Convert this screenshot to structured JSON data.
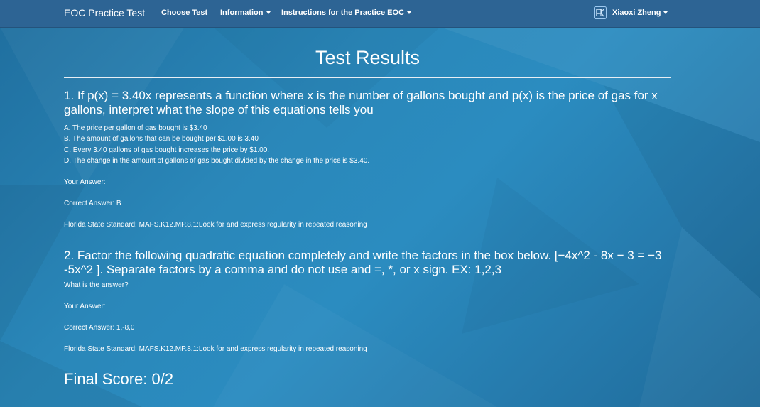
{
  "navbar": {
    "brand": "EOC Practice Test",
    "items": [
      {
        "label": "Choose Test"
      },
      {
        "label": "Information"
      },
      {
        "label": "Instructions for the Practice EOC"
      }
    ],
    "user": {
      "name": "Xiaoxi Zheng",
      "avatar_icon": "avatar-logo-icon"
    }
  },
  "page": {
    "title": "Test Results",
    "final_score": "Final Score: 0/2"
  },
  "questions": [
    {
      "text": "1. If p(x) = 3.40x represents a function where x is the number of gallons bought and p(x) is the price of gas for x gallons, interpret what the slope of this equations tells you",
      "choices": [
        "A. The price per gallon of gas bought is $3.40",
        "B. The amount of gallons that can be bought per $1.00 is 3.40",
        "C. Every 3.40 gallons of gas bought increases the price by $1.00.",
        "D. The change in the amount of gallons of gas bought divided by the change in the price is $3.40."
      ],
      "your_answer": "Your Answer:",
      "correct_answer": "Correct Answer: B",
      "standard": "Florida State Standard: MAFS.K12.MP.8.1:Look for and express regularity in repeated reasoning"
    },
    {
      "text": "2. Factor the following quadratic equation completely and write the factors in the box below. [−4x^2 - 8x − 3 = −3 -5x^2 ]. Separate factors by a comma and do not use and =, *, or x sign. EX: 1,2,3",
      "prompt": "What is the answer?",
      "your_answer": "Your Answer:",
      "correct_answer": "Correct Answer: 1,-8,0",
      "standard": "Florida State Standard: MAFS.K12.MP.8.1:Look for and express regularity in repeated reasoning"
    }
  ],
  "colors": {
    "navbar": "#2d6494",
    "background": "#2a87b9",
    "text": "#ffffff"
  }
}
